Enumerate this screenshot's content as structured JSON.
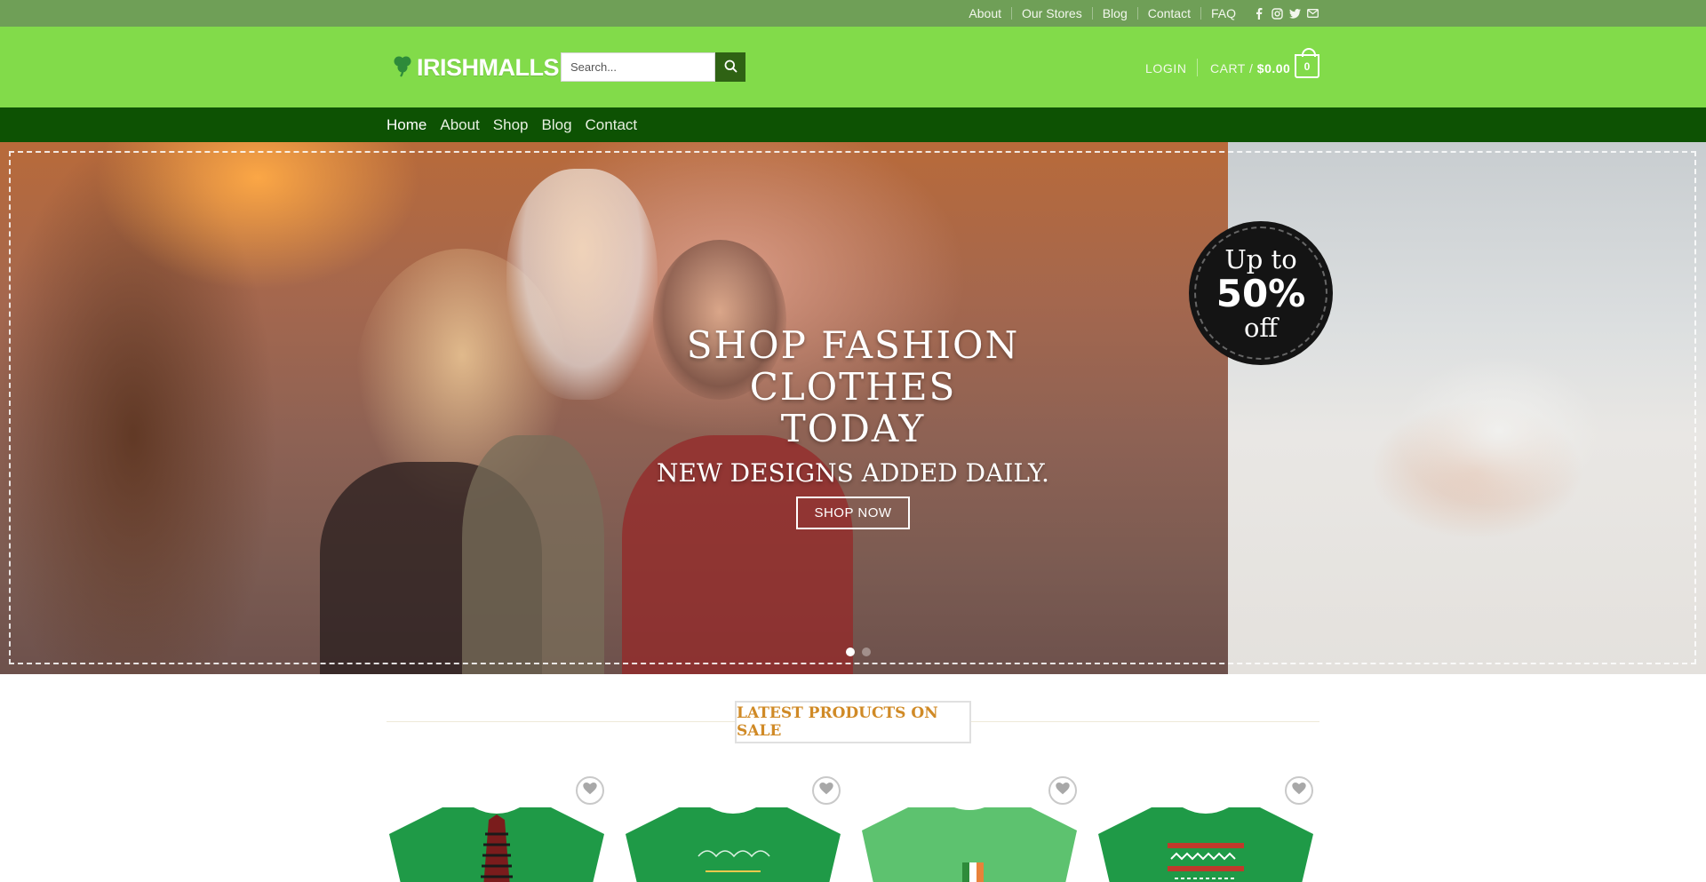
{
  "topbar": {
    "links": [
      "About",
      "Our Stores",
      "Blog",
      "Contact",
      "FAQ"
    ]
  },
  "header": {
    "logo_text": "IRISHMALLS",
    "search_placeholder": "Search...",
    "login_label": "LOGIN",
    "cart_label": "CART /",
    "cart_amount": "$0.00",
    "cart_count": "0"
  },
  "nav": {
    "items": [
      "Home",
      "About",
      "Shop",
      "Blog",
      "Contact"
    ]
  },
  "hero": {
    "title_line1": "SHOP FASHION CLOTHES",
    "title_line2": "TODAY",
    "subtitle": "NEW DESIGNS ADDED DAILY.",
    "button_label": "SHOP NOW",
    "badge_line1": "Up to",
    "badge_line2": "50%",
    "badge_line3": "off",
    "slide_count": 2,
    "active_slide": 0
  },
  "latest": {
    "title": "LATEST PRODUCTS ON SALE"
  },
  "products": [
    {
      "color": "#1f9a47",
      "name": "gnome-shirt"
    },
    {
      "color": "#1f9a47",
      "name": "merry-christmas-shirt"
    },
    {
      "color": "#5dc26f",
      "name": "irish-heart-shirt"
    },
    {
      "color": "#1f9a47",
      "name": "ugly-sweater-shirt"
    }
  ],
  "colors": {
    "topbar": "#6f9f57",
    "header": "#82db4a",
    "nav": "#0d5203",
    "search_button": "#2f6214",
    "section_title": "#d08a26"
  }
}
